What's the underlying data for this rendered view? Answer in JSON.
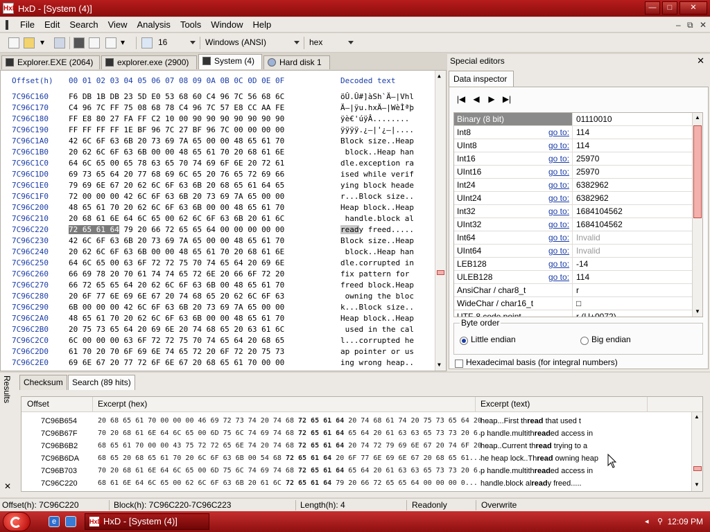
{
  "window": {
    "title": "HxD - [System (4)]",
    "app_icon": "HxD",
    "controls": [
      "—",
      "□",
      "✕"
    ]
  },
  "menu": {
    "items": [
      "File",
      "Edit",
      "Search",
      "View",
      "Analysis",
      "Tools",
      "Window",
      "Help"
    ],
    "mdi_controls": [
      "–",
      "⧉",
      "✕"
    ]
  },
  "toolbar": {
    "icons": [
      "new-file-icon",
      "open-folder-icon",
      "save-icon",
      "disk-icon",
      "copy-icon",
      "paste-icon",
      "columns-icon"
    ],
    "columns_value": "16",
    "charset_value": "Windows (ANSI)",
    "offset_base_value": "hex"
  },
  "doc_tabs": [
    {
      "label": "Explorer.EXE (2064)",
      "active": false
    },
    {
      "label": "explorer.exe (2900)",
      "active": false
    },
    {
      "label": "System (4)",
      "active": true
    },
    {
      "label": "Hard disk 1",
      "active": false
    }
  ],
  "hexview": {
    "header_offset": "Offset(h)",
    "header_cols": "00 01 02 03 04 05 06 07 08 09 0A 0B 0C 0D 0E 0F",
    "header_text": "Decoded text",
    "rows": [
      {
        "offset": "7C96C160",
        "bytes": "F6 DB 1B DB 23 5D E0 53 68 60 C4 96 7C 56 68 6C",
        "text": "öÛ.Û#]àSh`Ä–|Vhl"
      },
      {
        "offset": "7C96C170",
        "bytes": "C4 96 7C FF 75 08 68 78 C4 96 7C 57 E8 CC AA FE",
        "text": "Ä–|ÿu.hxÄ–|WèÌªþ"
      },
      {
        "offset": "7C96C180",
        "bytes": "FF E8 80 27 FA FF C2 10 00 90 90 90 90 90 90 90",
        "text": "ÿè€'úÿÂ........"
      },
      {
        "offset": "7C96C190",
        "bytes": "FF FF FF FF 1E BF 96 7C 27 BF 96 7C 00 00 00 00",
        "text": "ÿÿÿÿ.¿–|'¿–|...."
      },
      {
        "offset": "7C96C1A0",
        "bytes": "42 6C 6F 63 6B 20 73 69 7A 65 00 00 48 65 61 70",
        "text": "Block size..Heap"
      },
      {
        "offset": "7C96C1B0",
        "bytes": "20 62 6C 6F 63 6B 00 00 48 65 61 70 20 68 61 6E",
        "text": " block..Heap han"
      },
      {
        "offset": "7C96C1C0",
        "bytes": "64 6C 65 00 65 78 63 65 70 74 69 6F 6E 20 72 61",
        "text": "dle.exception ra"
      },
      {
        "offset": "7C96C1D0",
        "bytes": "69 73 65 64 20 77 68 69 6C 65 20 76 65 72 69 66",
        "text": "ised while verif"
      },
      {
        "offset": "7C96C1E0",
        "bytes": "79 69 6E 67 20 62 6C 6F 63 6B 20 68 65 61 64 65",
        "text": "ying block heade"
      },
      {
        "offset": "7C96C1F0",
        "bytes": "72 00 00 00 42 6C 6F 63 6B 20 73 69 7A 65 00 00",
        "text": "r...Block size.."
      },
      {
        "offset": "7C96C200",
        "bytes": "48 65 61 70 20 62 6C 6F 63 6B 00 00 48 65 61 70",
        "text": "Heap block..Heap"
      },
      {
        "offset": "7C96C210",
        "bytes": "20 68 61 6E 64 6C 65 00 62 6C 6F 63 6B 20 61 6C",
        "text": " handle.block al"
      },
      {
        "offset": "7C96C220",
        "bytes": "72 65 61 64 79 20 66 72 65 65 64 00 00 00 00 00",
        "text": "ready freed.....",
        "selected": true
      },
      {
        "offset": "7C96C230",
        "bytes": "42 6C 6F 63 6B 20 73 69 7A 65 00 00 48 65 61 70",
        "text": "Block size..Heap"
      },
      {
        "offset": "7C96C240",
        "bytes": "20 62 6C 6F 63 6B 00 00 48 65 61 70 20 68 61 6E",
        "text": " block..Heap han"
      },
      {
        "offset": "7C96C250",
        "bytes": "64 6C 65 00 63 6F 72 72 75 70 74 65 64 20 69 6E",
        "text": "dle.corrupted in"
      },
      {
        "offset": "7C96C260",
        "bytes": "66 69 78 20 70 61 74 74 65 72 6E 20 66 6F 72 20",
        "text": "fix pattern for "
      },
      {
        "offset": "7C96C270",
        "bytes": "66 72 65 65 64 20 62 6C 6F 63 6B 00 48 65 61 70",
        "text": "freed block.Heap"
      },
      {
        "offset": "7C96C280",
        "bytes": "20 6F 77 6E 69 6E 67 20 74 68 65 20 62 6C 6F 63",
        "text": " owning the bloc"
      },
      {
        "offset": "7C96C290",
        "bytes": "6B 00 00 00 42 6C 6F 63 6B 20 73 69 7A 65 00 00",
        "text": "k...Block size.."
      },
      {
        "offset": "7C96C2A0",
        "bytes": "48 65 61 70 20 62 6C 6F 63 6B 00 00 48 65 61 70",
        "text": "Heap block..Heap"
      },
      {
        "offset": "7C96C2B0",
        "bytes": "20 75 73 65 64 20 69 6E 20 74 68 65 20 63 61 6C",
        "text": " used in the cal"
      },
      {
        "offset": "7C96C2C0",
        "bytes": "6C 00 00 00 63 6F 72 72 75 70 74 65 64 20 68 65",
        "text": "l...corrupted he"
      },
      {
        "offset": "7C96C2D0",
        "bytes": "61 70 20 70 6F 69 6E 74 65 72 20 6F 72 20 75 73",
        "text": "ap pointer or us"
      },
      {
        "offset": "7C96C2E0",
        "bytes": "69 6E 67 20 77 72 6F 6E 67 20 68 65 61 70 00 00",
        "text": "ing wrong heap.."
      }
    ]
  },
  "special_editors": {
    "title": "Special editors",
    "close": "✕",
    "tab": "Data inspector",
    "nav_buttons": [
      "|◀",
      "◀",
      "▶",
      "▶|"
    ],
    "goto_label": "go to:",
    "rows": [
      {
        "name": "Binary (8 bit)",
        "value": "01110010",
        "goto": false,
        "highlight": true,
        "dim": false
      },
      {
        "name": "Int8",
        "value": "114",
        "goto": true,
        "highlight": false,
        "dim": false
      },
      {
        "name": "UInt8",
        "value": "114",
        "goto": true,
        "highlight": false,
        "dim": false
      },
      {
        "name": "Int16",
        "value": "25970",
        "goto": true,
        "highlight": false,
        "dim": false
      },
      {
        "name": "UInt16",
        "value": "25970",
        "goto": true,
        "highlight": false,
        "dim": false
      },
      {
        "name": "Int24",
        "value": "6382962",
        "goto": true,
        "highlight": false,
        "dim": false
      },
      {
        "name": "UInt24",
        "value": "6382962",
        "goto": true,
        "highlight": false,
        "dim": false
      },
      {
        "name": "Int32",
        "value": "1684104562",
        "goto": true,
        "highlight": false,
        "dim": false
      },
      {
        "name": "UInt32",
        "value": "1684104562",
        "goto": true,
        "highlight": false,
        "dim": false
      },
      {
        "name": "Int64",
        "value": "Invalid",
        "goto": true,
        "highlight": false,
        "dim": true
      },
      {
        "name": "UInt64",
        "value": "Invalid",
        "goto": true,
        "highlight": false,
        "dim": true
      },
      {
        "name": "LEB128",
        "value": "-14",
        "goto": true,
        "highlight": false,
        "dim": false
      },
      {
        "name": "ULEB128",
        "value": "114",
        "goto": true,
        "highlight": false,
        "dim": false
      },
      {
        "name": "AnsiChar / char8_t",
        "value": "r",
        "goto": false,
        "highlight": false,
        "dim": false
      },
      {
        "name": "WideChar / char16_t",
        "value": "□",
        "goto": false,
        "highlight": false,
        "dim": false
      },
      {
        "name": "UTF-8 code point",
        "value": "r (U+0072)",
        "goto": false,
        "highlight": false,
        "dim": false
      }
    ],
    "byte_order_label": "Byte order",
    "little_endian_label": "Little endian",
    "big_endian_label": "Big endian",
    "byte_order_selected": "little",
    "hex_basis_label": "Hexadecimal basis (for integral numbers)",
    "hex_basis_checked": false
  },
  "results": {
    "label": "Results",
    "close": "✕",
    "tabs": [
      {
        "label": "Checksum",
        "active": false
      },
      {
        "label": "Search (89 hits)",
        "active": true
      }
    ],
    "columns": [
      "Offset",
      "Excerpt (hex)",
      "Excerpt (text)"
    ],
    "rows": [
      {
        "offset": "7C96B654",
        "hex_pre": "20 68 65 61 70 00 00 00 46 69 72 73 74 20 74 68 ",
        "hex_hit": "72 65 61 64",
        "hex_post": " 20 74 68 61 74 20 75 73 65 64 20 ...",
        "txt_pre": " heap...First th",
        "txt_hit": "read",
        "txt_post": " that used t"
      },
      {
        "offset": "7C96B67F",
        "hex_pre": "70 20 68 61 6E 64 6C 65 00 6D 75 6C 74 69 74 68 ",
        "hex_hit": "72 65 61 64",
        "hex_post": " 65 64 20 61 63 63 65 73 73 20 6...",
        "txt_pre": "p handle.multith",
        "txt_hit": "read",
        "txt_post": "ed access in"
      },
      {
        "offset": "7C96B6B2",
        "hex_pre": "68 65 61 70 00 00 43 75 72 72 65 6E 74 20 74 68 ",
        "hex_hit": "72 65 61 64",
        "hex_post": " 20 74 72 79 69 6E 67 20 74 6F 20 ...",
        "txt_pre": "heap..Current th",
        "txt_hit": "read",
        "txt_post": " trying to a"
      },
      {
        "offset": "7C96B6DA",
        "hex_pre": "68 65 20 68 65 61 70 20 6C 6F 63 6B 00 54 68 ",
        "hex_hit": "72 65 61 64",
        "hex_post": " 20 6F 77 6E 69 6E 67 20 68 65 61...",
        "txt_pre": "he heap lock..Th",
        "txt_hit": "read",
        "txt_post": " owning heap"
      },
      {
        "offset": "7C96B703",
        "hex_pre": "70 20 68 61 6E 64 6C 65 00 6D 75 6C 74 69 74 68 ",
        "hex_hit": "72 65 61 64",
        "hex_post": " 65 64 20 61 63 63 65 73 73 20 6...",
        "txt_pre": "p handle.multith",
        "txt_hit": "read",
        "txt_post": "ed access in"
      },
      {
        "offset": "7C96C220",
        "hex_pre": "68 61 6E 64 6C 65 00 62 6C 6F 63 6B 20 61 6C ",
        "hex_hit": "72 65 61 64",
        "hex_post": " 79 20 66 72 65 65 64 00 00 00 0...",
        "txt_pre": " handle.block al",
        "txt_hit": "read",
        "txt_post": "y freed....."
      }
    ]
  },
  "statusbar": {
    "offset": "Offset(h): 7C96C220",
    "block": "Block(h): 7C96C220-7C96C223",
    "length": "Length(h): 4",
    "mode": "Readonly",
    "write_mode": "Overwrite"
  },
  "taskbar": {
    "task_label": "HxD - [System (4)]",
    "clock": "12:09 PM"
  },
  "colors": {
    "titlebar": "#b71c1c",
    "taskbar": "#c72f2f",
    "offset_blue": "#1a3ca8",
    "scroll_thumb": "#f3b1ad"
  }
}
